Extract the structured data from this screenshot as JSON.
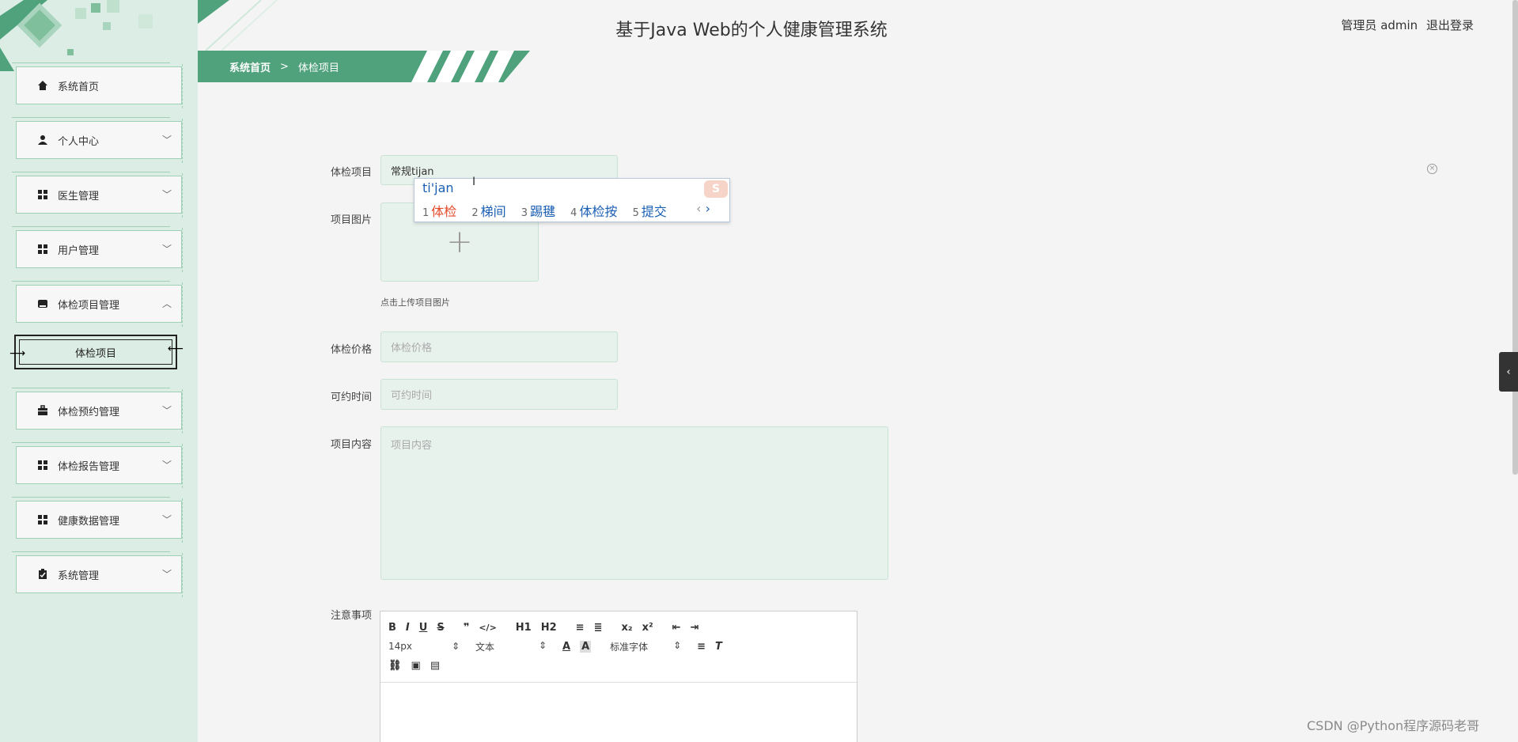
{
  "header": {
    "title": "基于Java Web的个人健康管理系统",
    "role": "管理员 admin",
    "logout": "退出登录"
  },
  "breadcrumb": {
    "home": "系统首页",
    "separator": ">",
    "current": "体检项目"
  },
  "sidebar": {
    "items": [
      {
        "label": "系统首页",
        "icon": "home-icon",
        "has_children": false
      },
      {
        "label": "个人中心",
        "icon": "user-icon",
        "has_children": true
      },
      {
        "label": "医生管理",
        "icon": "grid-icon",
        "has_children": true
      },
      {
        "label": "用户管理",
        "icon": "grid-icon",
        "has_children": true
      },
      {
        "label": "体检项目管理",
        "icon": "inbox-icon",
        "has_children": true,
        "expanded": true
      },
      {
        "label": "体检预约管理",
        "icon": "briefcase-icon",
        "has_children": true
      },
      {
        "label": "体检报告管理",
        "icon": "grid-icon",
        "has_children": true
      },
      {
        "label": "健康数据管理",
        "icon": "grid-icon",
        "has_children": true
      },
      {
        "label": "系统管理",
        "icon": "clipboard-icon",
        "has_children": true
      }
    ],
    "subitem": {
      "label": "体检项目"
    }
  },
  "form": {
    "name_label": "体检项目",
    "name_value": "常规tijan",
    "image_label": "项目图片",
    "image_hint": "点击上传项目图片",
    "price_label": "体检价格",
    "price_placeholder": "体检价格",
    "time_label": "可约时间",
    "time_placeholder": "可约时间",
    "content_label": "项目内容",
    "content_placeholder": "项目内容",
    "notes_label": "注意事项"
  },
  "ime": {
    "pinyin": "ti'jan",
    "candidates": [
      {
        "n": "1",
        "text": "体检"
      },
      {
        "n": "2",
        "text": "梯间"
      },
      {
        "n": "3",
        "text": "踢毽"
      },
      {
        "n": "4",
        "text": "体检按"
      },
      {
        "n": "5",
        "text": "提交"
      }
    ],
    "logo": "S"
  },
  "editor": {
    "row1": [
      "B",
      "I",
      "U",
      "S",
      "❞",
      "</>",
      "H1",
      "H2",
      "≡",
      "≣",
      "x₂",
      "x²",
      "⇤",
      "⇥"
    ],
    "font_size": "14px",
    "block_type": "文本",
    "font_family": "标准字体",
    "row3": [
      "🔗",
      "▣",
      "▤"
    ]
  },
  "watermark": "CSDN @Python程序源码老哥",
  "colors": {
    "accent": "#4fa27c",
    "sidebar_bg": "#dcede5",
    "field_bg": "#e8f2ed"
  }
}
